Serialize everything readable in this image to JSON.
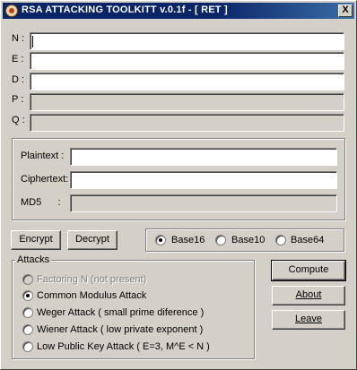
{
  "window": {
    "title": "RSA ATTACKING TOOLKITT v.0.1f - [ RET ]",
    "close_label": "X"
  },
  "key_fields": [
    {
      "label": "N :",
      "value": ""
    },
    {
      "label": "E :",
      "value": ""
    },
    {
      "label": "D :",
      "value": ""
    },
    {
      "label": "P :",
      "value": ""
    },
    {
      "label": "Q :",
      "value": ""
    }
  ],
  "crypto": {
    "plaintext_label": "Plaintext  :",
    "plaintext_value": "",
    "ciphertext_label": "Ciphertext:",
    "ciphertext_value": "",
    "md5_label": "MD5      :",
    "md5_value": ""
  },
  "actions": {
    "encrypt": "Encrypt",
    "decrypt": "Decrypt"
  },
  "base": {
    "options": [
      "Base16",
      "Base10",
      "Base64"
    ],
    "selected": "Base16"
  },
  "attacks": {
    "title": "Attacks",
    "options": [
      "Factoring N (not present)",
      "Common Modulus Attack",
      "Weger Attack ( small prime diference )",
      "Wiener Attack ( low private exponent )",
      "Low Public Key Attack ( E=3, M^E < N )"
    ],
    "selected": "Common Modulus Attack",
    "disabled": [
      "Factoring N (not present)"
    ]
  },
  "side_buttons": {
    "compute": "Compute",
    "about": "About",
    "leave": "Leave"
  }
}
